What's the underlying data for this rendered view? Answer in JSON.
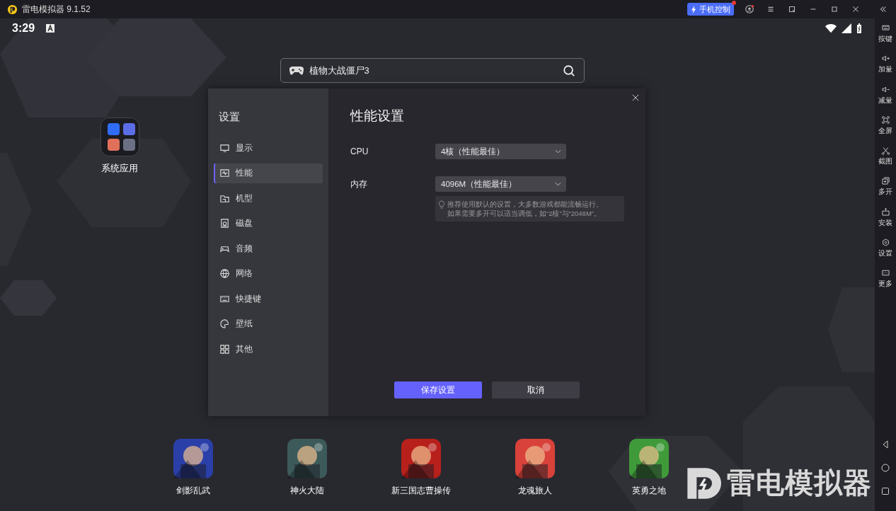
{
  "titlebar": {
    "app_name": "雷电模拟器 9.1.52",
    "phone_control": {
      "label": "手机控制",
      "notification": true
    }
  },
  "status_bar": {
    "time": "3:29"
  },
  "search": {
    "value": "植物大战僵尸3"
  },
  "folder": {
    "label": "系统应用"
  },
  "toolbar": [
    {
      "label": "按键"
    },
    {
      "label": "加量"
    },
    {
      "label": "减量"
    },
    {
      "label": "全屏"
    },
    {
      "label": "截图"
    },
    {
      "label": "多开"
    },
    {
      "label": "安装"
    },
    {
      "label": "设置"
    },
    {
      "label": "更多"
    }
  ],
  "apps": [
    {
      "label": "剑影乱武"
    },
    {
      "label": "神火大陆"
    },
    {
      "label": "新三国志曹操传"
    },
    {
      "label": "龙魂旅人"
    },
    {
      "label": "英勇之地"
    }
  ],
  "brand": {
    "text": "雷电模拟器"
  },
  "settings": {
    "title": "设置",
    "menu": [
      {
        "label": "显示",
        "selected": false
      },
      {
        "label": "性能",
        "selected": true
      },
      {
        "label": "机型",
        "selected": false
      },
      {
        "label": "磁盘",
        "selected": false
      },
      {
        "label": "音频",
        "selected": false
      },
      {
        "label": "网络",
        "selected": false
      },
      {
        "label": "快捷键",
        "selected": false
      },
      {
        "label": "壁纸",
        "selected": false
      },
      {
        "label": "其他",
        "selected": false
      }
    ],
    "heading": "性能设置",
    "fields": [
      {
        "label": "CPU",
        "value": "4核（性能最佳）"
      },
      {
        "label": "内存",
        "value": "4096M（性能最佳）"
      }
    ],
    "hint": [
      "推荐使用默认的设置，大多数游戏都能流畅运行。",
      "如果需要多开可以适当调低，如“2核”与“2048M”。"
    ],
    "buttons": [
      {
        "label": "保存设置",
        "kind": "primary"
      },
      {
        "label": "取消",
        "kind": "secondary"
      }
    ]
  }
}
